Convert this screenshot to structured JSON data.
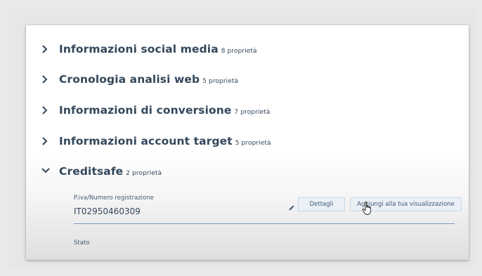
{
  "groups": [
    {
      "title": "Informazioni social media",
      "count": "8 proprietà"
    },
    {
      "title": "Cronologia analisi web",
      "count": "5 proprietà"
    },
    {
      "title": "Informazioni di conversione",
      "count": "7 proprietà"
    },
    {
      "title": "Informazioni account target",
      "count": "5 proprietà"
    },
    {
      "title": "Creditsafe",
      "count": "2 proprietà"
    }
  ],
  "creditsafe": {
    "registration_label": "P.iva/Numero registrazione",
    "registration_value": "IT02950460309",
    "details_button": "Dettagli",
    "add_view_button": "Aggiungi alla tua visualizzazione",
    "status_label": "Stato"
  },
  "icons": {
    "collapsed": "chevron-right-icon",
    "expanded": "chevron-down-icon",
    "edit": "pencil-icon",
    "cursor": "hand-pointer-icon"
  },
  "colors": {
    "text": "#33475b",
    "chevron": "#33475b",
    "underline": "#7c98b6",
    "button_bg": "#eaf0f6"
  }
}
